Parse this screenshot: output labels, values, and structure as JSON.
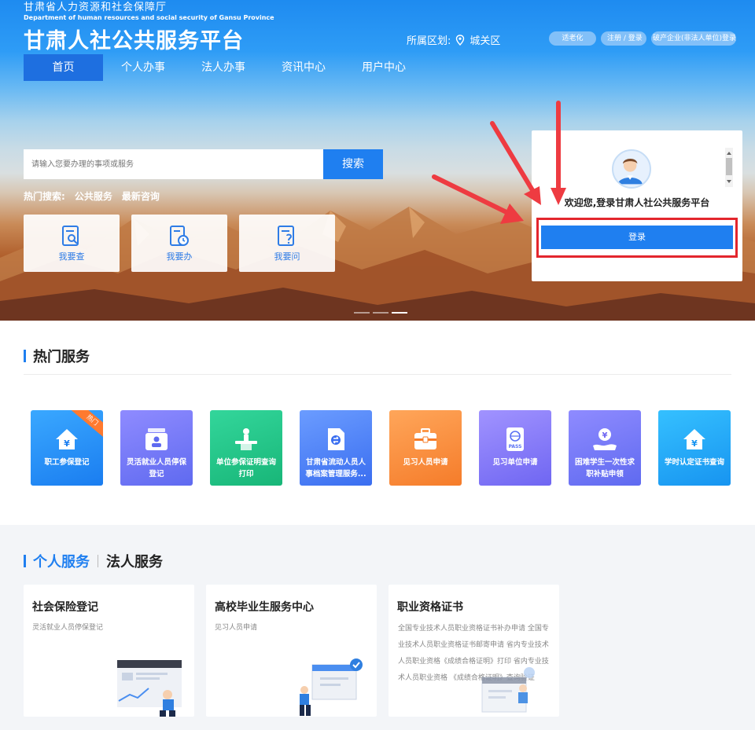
{
  "header": {
    "org_cn": "甘肃省人力资源和社会保障厅",
    "org_en": "Department of human resources and social security of Gansu Province",
    "site_title": "甘肃人社公共服务平台",
    "region_label": "所属区划:",
    "region_value": "城关区",
    "buttons": [
      "适老化",
      "注册 / 登录",
      "破产企业(非法人单位)登录"
    ]
  },
  "nav": {
    "items": [
      "首页",
      "个人办事",
      "法人办事",
      "资讯中心",
      "用户中心"
    ],
    "active_index": 0
  },
  "search": {
    "placeholder": "请输入您要办理的事项或服务",
    "button_label": "搜索",
    "hot_label": "热门搜索:",
    "hot_terms": [
      "公共服务",
      "最新咨询"
    ]
  },
  "quick_actions": [
    {
      "label": "我要查",
      "icon": "search-document-icon"
    },
    {
      "label": "我要办",
      "icon": "clock-document-icon"
    },
    {
      "label": "我要问",
      "icon": "question-document-icon"
    }
  ],
  "login_panel": {
    "welcome": "欢迎您,登录甘肃人社公共服务平台",
    "button_label": "登录"
  },
  "hot_services": {
    "title": "热门服务",
    "badge": "热门",
    "items": [
      {
        "lines": [
          "职工参保登记"
        ],
        "icon": "house-yen-icon",
        "color": "#2a8ff5"
      },
      {
        "lines": [
          "灵活就业人员停保",
          "登记"
        ],
        "icon": "person-card-icon",
        "color": "#7479f5"
      },
      {
        "lines": [
          "单位参保证明查询",
          "打印"
        ],
        "icon": "podium-person-icon",
        "color": "#22c486"
      },
      {
        "lines": [
          "甘肃省流动人员人",
          "事档案管理服务..."
        ],
        "icon": "file-transfer-icon",
        "color": "#4e80f4"
      },
      {
        "lines": [
          "见习人员申请"
        ],
        "icon": "briefcase-icon",
        "color": "#fa9144"
      },
      {
        "lines": [
          "见习单位申请"
        ],
        "icon": "passport-icon",
        "color": "#5b72f4"
      },
      {
        "lines": [
          "困难学生一次性求",
          "职补贴申领"
        ],
        "icon": "hand-coin-icon",
        "color": "#877cf8"
      },
      {
        "lines": [
          "学时认定证书查询"
        ],
        "icon": "house-yen-icon",
        "color": "#22a8f6"
      }
    ]
  },
  "service_tabs": {
    "active": "个人服务",
    "inactive": "法人服务"
  },
  "service_cards": [
    {
      "title": "社会保险登记",
      "subtitle": "灵活就业人员停保登记"
    },
    {
      "title": "高校毕业生服务中心",
      "subtitle": "见习人员申请"
    },
    {
      "title": "职业资格证书",
      "text": "全国专业技术人员职业资格证书补办申请 全国专业技术人员职业资格证书邮寄申请 省内专业技术人员职业资格《成绩合格证明》打印 省内专业技术人员职业资格 《成绩合格证明》查询验证"
    }
  ],
  "colors": {
    "primary": "#1f7ff0",
    "highlight_border": "#e3262d",
    "arrow": "#ee3b41"
  }
}
